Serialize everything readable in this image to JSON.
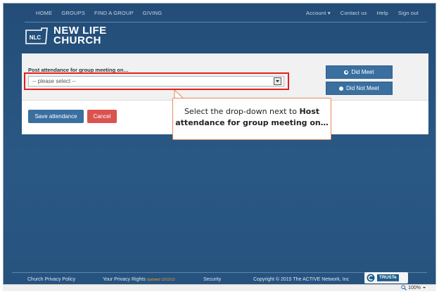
{
  "nav": {
    "left": [
      "HOME",
      "GROUPS",
      "FIND A GROUP",
      "GIVING"
    ],
    "account": "Account ▾",
    "contact": "Contact us",
    "help": "Help",
    "signout": "Sign out"
  },
  "logo": {
    "mark": "NLC",
    "line1": "NEW LIFE",
    "line2": "CHURCH"
  },
  "form": {
    "label": "Post attendance for group meeting on…",
    "select_value": "-- please select --",
    "did_meet": "Did Meet",
    "did_not_meet": "Did Not Meet",
    "save": "Save attendance",
    "cancel": "Cancel"
  },
  "callout": {
    "prefix": "Select the drop-down next to ",
    "bold": "Host attendance for group meeting on…"
  },
  "footer": {
    "privacy": "Church Privacy Policy",
    "rights": "Your Privacy Rights",
    "updated": "Updated 12/12/13",
    "security": "Security",
    "copyright": "Copyright © 2015 The ACTIVE Network, Inc",
    "truste": "TRUSTe",
    "truste_sub": "Certified Privacy"
  },
  "status": {
    "zoom": "100%"
  },
  "colors": {
    "background": "#24507c",
    "primary_button": "#3a6fa0",
    "cancel_button": "#d9534f",
    "highlight": "#e02020",
    "callout_border": "#e8875a"
  }
}
